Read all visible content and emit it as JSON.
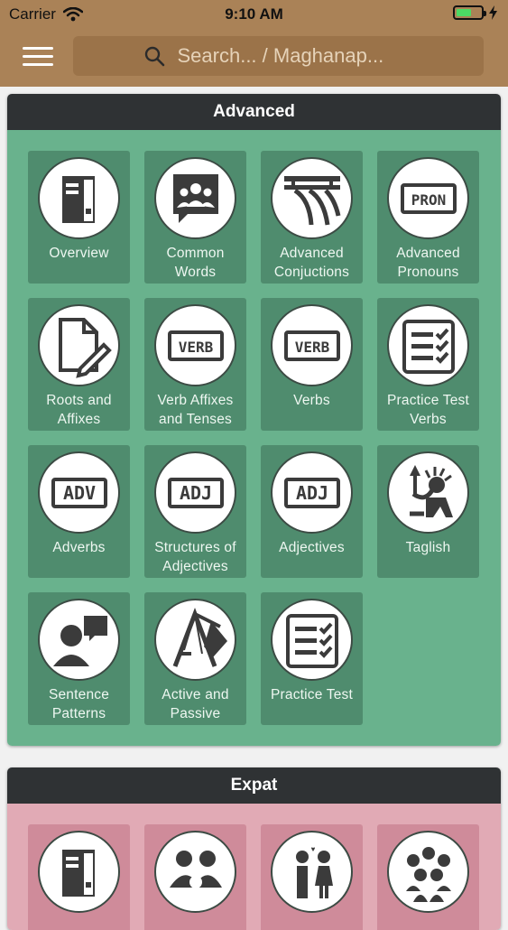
{
  "status": {
    "carrier": "Carrier",
    "time": "9:10 AM",
    "battery_level": 0.6
  },
  "search": {
    "placeholder": "Search... / Maghanap..."
  },
  "colors": {
    "header": "#aa8257",
    "advanced_bg": "#69b28d",
    "advanced_tile": "#4f8c6e",
    "expat_bg": "#e1aab5",
    "panel_title": "#2f3234"
  },
  "advanced": {
    "title": "Advanced",
    "tiles": [
      {
        "label": "Overview",
        "icon": "binder-icon"
      },
      {
        "label": "Common\nWords",
        "icon": "group-chat-icon"
      },
      {
        "label": "Advanced\nConjuctions",
        "icon": "bridge-icon"
      },
      {
        "label": "Advanced\nPronouns",
        "icon": "pron-sign-icon"
      },
      {
        "label": "Roots and\nAffixes",
        "icon": "document-pen-icon"
      },
      {
        "label": "Verb Affixes\nand Tenses",
        "icon": "verb-sign-icon"
      },
      {
        "label": "Verbs",
        "icon": "verb-sign-icon"
      },
      {
        "label": "Practice Test\nVerbs",
        "icon": "checklist-icon"
      },
      {
        "label": "Adverbs",
        "icon": "adv-sign-icon"
      },
      {
        "label": "Structures of\nAdjectives",
        "icon": "adj-sign-icon"
      },
      {
        "label": "Adjectives",
        "icon": "adj-sign-icon"
      },
      {
        "label": "Taglish",
        "icon": "statue-icon"
      },
      {
        "label": "Sentence\nPatterns",
        "icon": "speaker-icon"
      },
      {
        "label": "Active and\nPassive",
        "icon": "swing-icon"
      },
      {
        "label": "Practice Test",
        "icon": "checklist-icon"
      }
    ]
  },
  "expat": {
    "title": "Expat",
    "tiles": [
      {
        "icon": "binder-icon"
      },
      {
        "icon": "family-icon"
      },
      {
        "icon": "couple-icon"
      },
      {
        "icon": "crowd-icon"
      }
    ]
  }
}
